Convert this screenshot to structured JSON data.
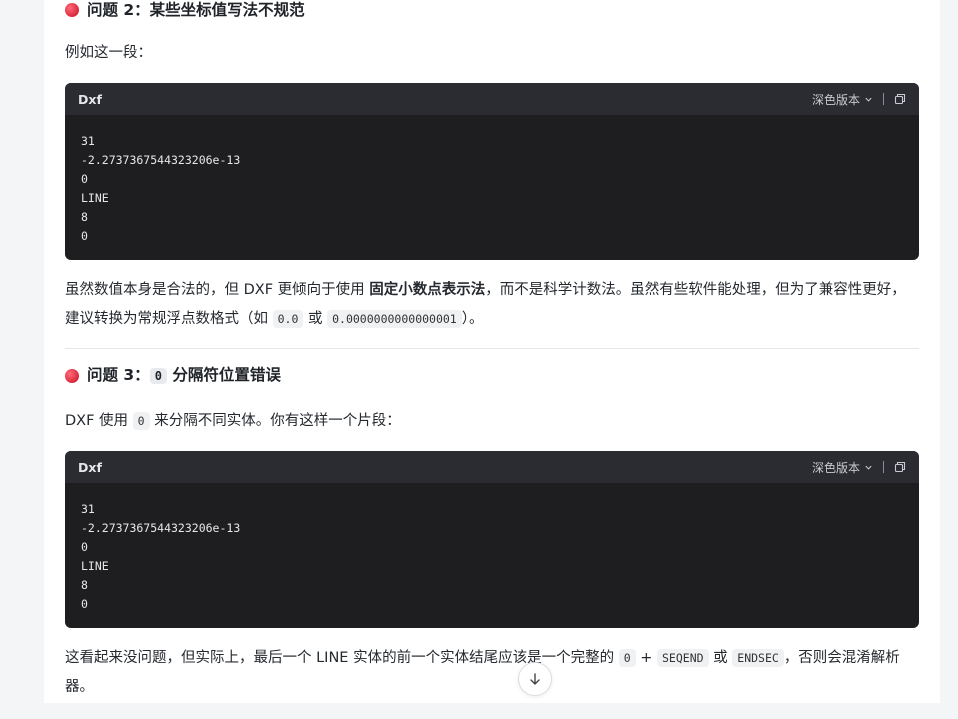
{
  "issue2": {
    "title": "问题 2：某些坐标值写法不规范",
    "intro": "例如这一段："
  },
  "codeblock1": {
    "language": "Dxf",
    "theme_label": "深色版本",
    "lines": [
      "31",
      "-2.2737367544323206e-13",
      "0",
      "LINE",
      "8",
      "0"
    ]
  },
  "para2": {
    "part1": "虽然数值本身是合法的，但 DXF 更倾向于使用 ",
    "bold": "固定小数点表示法",
    "part2": "，而不是科学计数法。虽然有些软件能处理，但为了兼容性更好，建议转换为常规浮点数格式（如 ",
    "code1": "0.0",
    "part3": " 或 ",
    "code2": "0.0000000000000001",
    "part4": "）。"
  },
  "issue3": {
    "prefix": "问题 3：",
    "code": "0",
    "suffix": " 分隔符位置错误"
  },
  "para3": {
    "part1": "DXF 使用 ",
    "code": "0",
    "part2": " 来分隔不同实体。你有这样一个片段："
  },
  "codeblock2": {
    "language": "Dxf",
    "theme_label": "深色版本",
    "lines": [
      "31",
      "-2.2737367544323206e-13",
      "0",
      "LINE",
      "8",
      "0"
    ]
  },
  "para4": {
    "part1": "这看起来没问题，但实际上，最后一个 LINE 实体的前一个实体结尾应该是一个完整的 ",
    "code1": "0",
    "plus": " + ",
    "code2": "SEQEND",
    "part2": " 或 ",
    "code3": "ENDSEC",
    "part3": "，否则会混淆解析器。"
  }
}
